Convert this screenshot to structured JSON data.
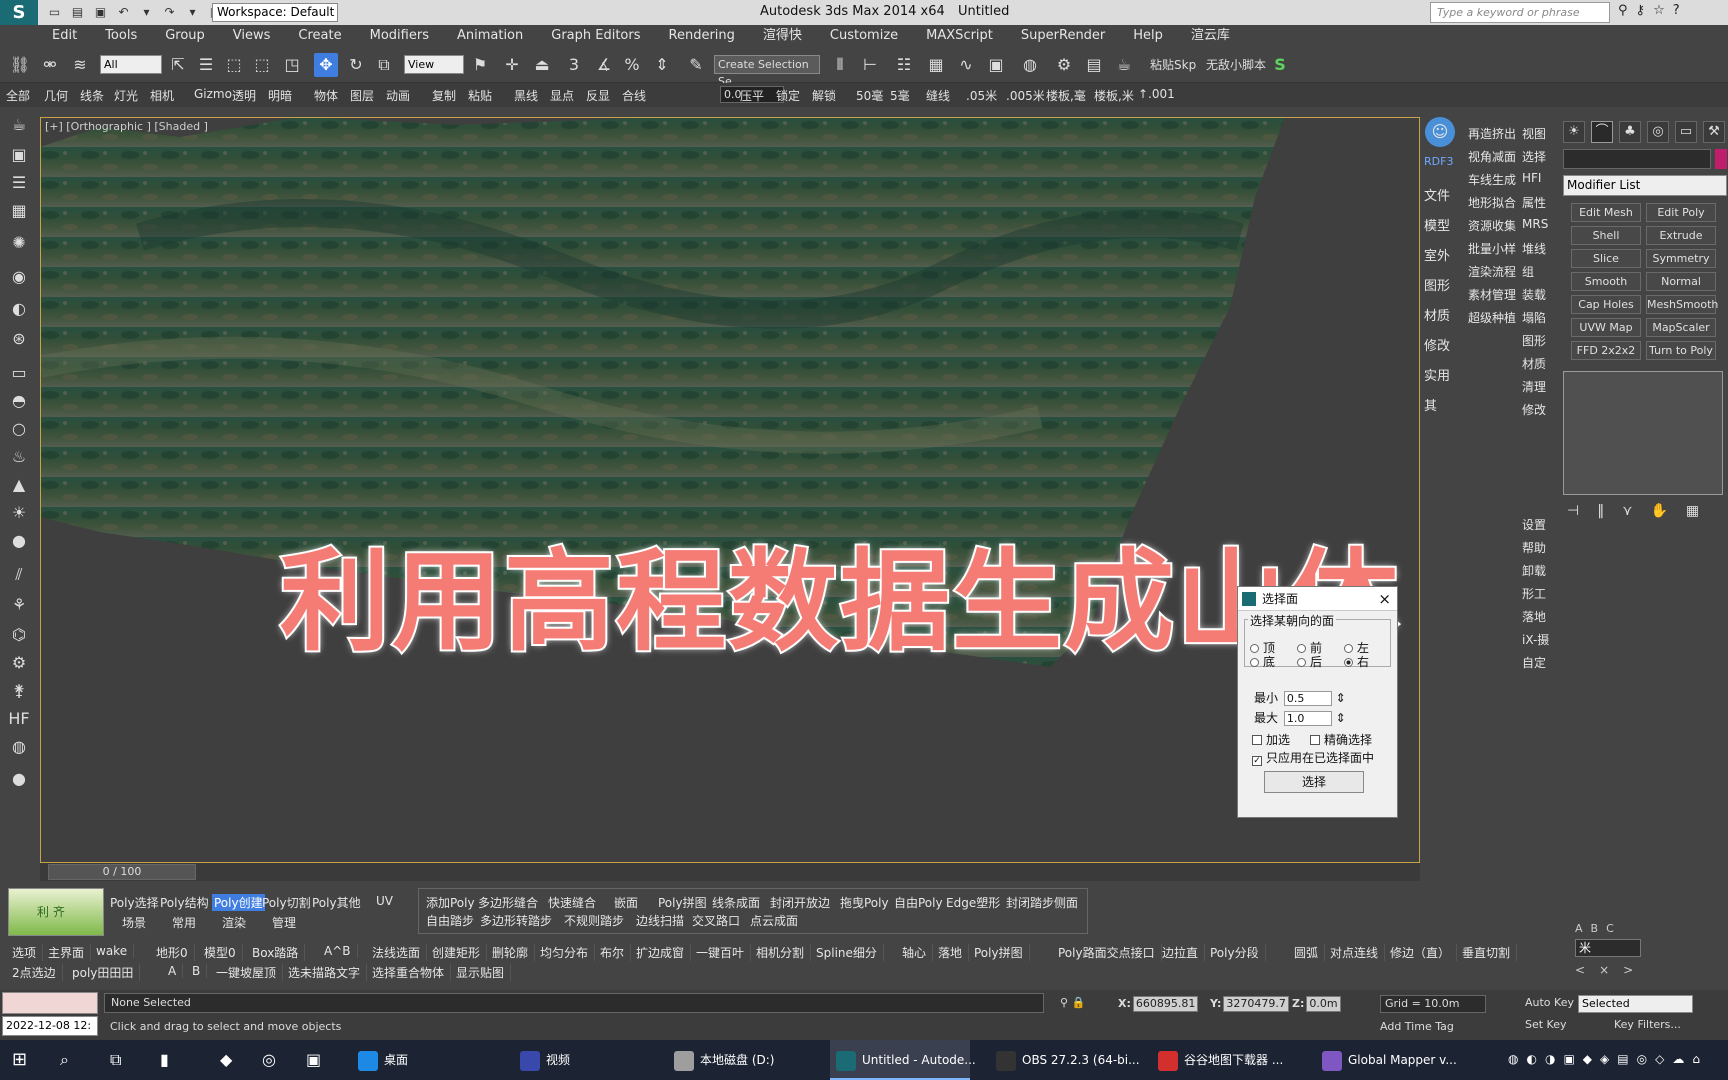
{
  "titlebar": {
    "workspace": "Workspace: Default",
    "app_title": "Autodesk 3ds Max  2014 x64",
    "doc_title": "Untitled",
    "search_placeholder": "Type a keyword or phrase"
  },
  "menu": [
    "Edit",
    "Tools",
    "Group",
    "Views",
    "Create",
    "Modifiers",
    "Animation",
    "Graph Editors",
    "Rendering",
    "渲得快",
    "Customize",
    "MAXScript",
    "SuperRender",
    "Help",
    "渲云库"
  ],
  "toolbar": {
    "filter": "All",
    "refcoord": "View",
    "snap_label": "3",
    "selection_set": "Create Selection Se",
    "plugin1": "粘贴Skp",
    "plugin2": "无敌小脚本"
  },
  "command_bar": [
    "全部",
    "几何",
    "线条",
    "灯光",
    "相机",
    "Gizmo",
    "透明",
    "明暗",
    "物体",
    "图层",
    "动画",
    "复制",
    "粘贴",
    "黑线",
    "显点",
    "反显",
    "合线",
    "压平",
    "锁定",
    "解锁",
    "50毫",
    "5毫",
    "缝线",
    ".05米",
    ".005米",
    "楼板,毫",
    "楼板,米",
    "↑.001"
  ],
  "command_spin": "0.0",
  "viewport": {
    "label": "[+] [Orthographic ] [Shaded ]",
    "overlay": "利用高程数据生成山体"
  },
  "dialog": {
    "title": "选择面",
    "group": "选择某朝向的面",
    "radios": [
      {
        "label": "顶",
        "on": false
      },
      {
        "label": "前",
        "on": false
      },
      {
        "label": "左",
        "on": false
      },
      {
        "label": "底",
        "on": false
      },
      {
        "label": "后",
        "on": false
      },
      {
        "label": "右",
        "on": true
      }
    ],
    "min_label": "最小",
    "min_value": "0.5",
    "max_label": "最大",
    "max_value": "1.0",
    "chk_add": "加选",
    "chk_precise": "精确选择",
    "chk_only": "只应用在已选择面中",
    "button": "选择"
  },
  "right_col1": [
    "RDF3",
    "文件",
    "模型",
    "室外",
    "图形",
    "材质",
    "修改",
    "实用",
    "其"
  ],
  "right_col2a": [
    "再造挤出",
    "视角减面",
    "车线生成",
    "地形拟合",
    "资源收集",
    "批量小样",
    "渲染流程",
    "素材管理",
    "超级种植"
  ],
  "right_col2b": [
    "视图",
    "选择",
    "HFI",
    "属性",
    "MRS",
    "堆线",
    "组",
    "装载",
    "塌陷",
    "图形",
    "材质",
    "清理",
    "修改",
    "",
    "",
    "",
    "",
    "设置",
    "帮助",
    "卸载",
    "形工",
    "落地",
    "iX-摄",
    "自定"
  ],
  "modifier_list": "Modifier List",
  "mod_buttons": [
    "Edit Mesh",
    "Edit Poly",
    "Shell",
    "Extrude",
    "Slice",
    "Symmetry",
    "Smooth",
    "Normal",
    "Cap Holes",
    "MeshSmooth",
    "UVW Map",
    "MapScaler",
    "FFD 2x2x2",
    "Turn to Poly"
  ],
  "cmd_tabs": [
    "☀",
    "⌒",
    "♣",
    "◎",
    "▭",
    "⚒"
  ],
  "abc": [
    "A",
    "B",
    "C"
  ],
  "star_field": "米",
  "time_slider": "0 / 100",
  "bottom_logo": "利 齐",
  "poly_tabs": [
    "Poly选择",
    "Poly结构",
    "Poly创建",
    "Poly切割",
    "Poly其他",
    "UV",
    "场景",
    "常用",
    "渲染",
    "管理"
  ],
  "poly_tools_row1": [
    "添加Poly",
    "多边形缝合",
    "快速缝合",
    "嵌面",
    "Poly拼图",
    "线条成面",
    "封闭开放边",
    "拖曳Poly",
    "自由Poly",
    "Edge塑形",
    "封闭踏步侧面"
  ],
  "poly_tools_row2": [
    "自由踏步",
    "多边形转踏步",
    "不规则踏步",
    "边线扫描",
    "交叉路口",
    "点云成面"
  ],
  "bottom_row1": [
    "选项",
    "主界面",
    "wake",
    "地形0",
    "模型0",
    "Box踏路",
    "A^B",
    "法线选面",
    "创建矩形",
    "删轮廓",
    "均匀分布",
    "布尔",
    "扩边成窗",
    "一键百叶",
    "相机分割",
    "Spline细分",
    "轴心",
    "落地",
    "Poly拼图",
    "Poly路面交点接口",
    "边拉直",
    "Poly分段",
    "圆弧",
    "对点连线",
    "修边（直）",
    "垂直切割"
  ],
  "bottom_row2": [
    "2点选边",
    "poly田田田",
    "A",
    "B",
    "一键坡屋顶",
    "选未描路文字",
    "选择重合物体",
    "显示贴图"
  ],
  "status": {
    "date": "2022-12-08 12:",
    "selection": "None Selected",
    "hint": "Click and drag to select and move objects",
    "x_label": "X:",
    "x_value": "660895.81",
    "y_label": "Y:",
    "y_value": "3270479.7",
    "z_label": "Z:",
    "z_value": "0.0m",
    "grid": "Grid = 10.0m",
    "add_time_tag": "Add Time Tag",
    "auto_key": "Auto Key",
    "set_key": "Set Key",
    "selected": "Selected",
    "key_filters": "Key Filters..."
  },
  "taskbar": [
    {
      "label": "桌面",
      "color": "#1e88e5"
    },
    {
      "label": "视频",
      "color": "#3949ab"
    },
    {
      "label": "本地磁盘 (D:)",
      "color": "#9e9e9e"
    },
    {
      "label": "Untitled - Autode...",
      "color": "#1a6b74"
    },
    {
      "label": "OBS 27.2.3 (64-bi...",
      "color": "#333"
    },
    {
      "label": "谷谷地图下载器 ...",
      "color": "#d32f2f"
    },
    {
      "label": "Global Mapper v...",
      "color": "#7e57c2"
    }
  ]
}
